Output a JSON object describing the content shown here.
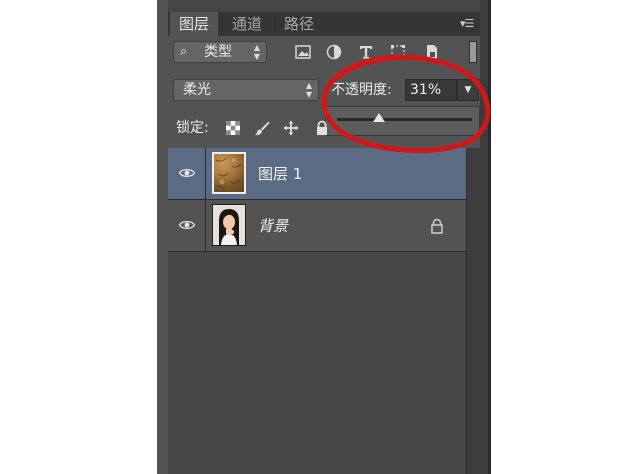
{
  "tabs": [
    {
      "label": "图层",
      "active": true
    },
    {
      "label": "通道",
      "active": false
    },
    {
      "label": "路径",
      "active": false
    }
  ],
  "filter": {
    "label": "类型",
    "icons": [
      "image-filter-icon",
      "adjustment-filter-icon",
      "type-filter-icon",
      "shape-filter-icon",
      "smart-object-filter-icon"
    ]
  },
  "blend_mode": {
    "value": "柔光"
  },
  "opacity": {
    "label": "不透明度:",
    "value": "31%",
    "fraction": 0.31
  },
  "lock": {
    "label": "锁定:",
    "icons": [
      "lock-transparent-icon",
      "lock-pixels-icon",
      "lock-position-icon",
      "lock-all-icon"
    ]
  },
  "layers": [
    {
      "name": "图层 1",
      "selected": true,
      "visible": true,
      "locked": false,
      "thumb": "texture"
    },
    {
      "name": "背景",
      "selected": false,
      "visible": true,
      "locked": true,
      "thumb": "portrait"
    }
  ],
  "colors": {
    "panel": "#535353",
    "selection": "#5b6b83",
    "annotation": "#d01818"
  }
}
